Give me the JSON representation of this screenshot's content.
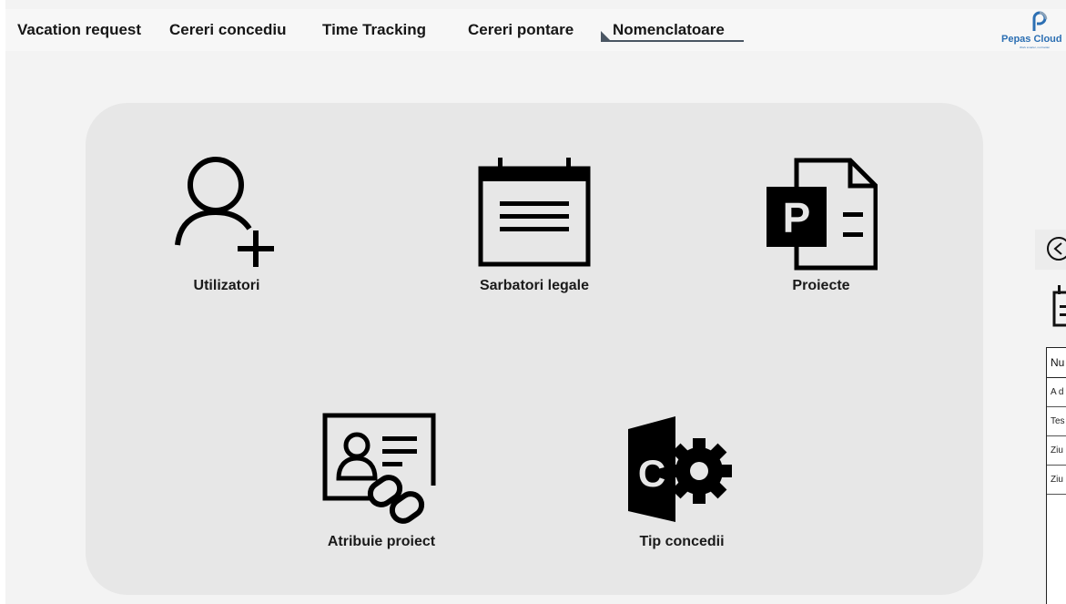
{
  "nav": {
    "items": [
      {
        "label": "Vacation request"
      },
      {
        "label": "Cereri concediu"
      },
      {
        "label": "Time Tracking"
      },
      {
        "label": "Cereri pontare"
      },
      {
        "label": "Nomenclatoare"
      }
    ],
    "active": "Nomenclatoare"
  },
  "logo": {
    "text": "Pepas Cloud",
    "tagline": "Work smarter, not harder"
  },
  "tiles": [
    {
      "label": "Utilizatori",
      "icon": "add-user-icon"
    },
    {
      "label": "Sarbatori legale",
      "icon": "calendar-icon"
    },
    {
      "label": "Proiecte",
      "icon": "project-file-icon"
    },
    {
      "label": "Atribuie proiect",
      "icon": "contact-card-link-icon"
    },
    {
      "label": "Tip concedii",
      "icon": "office-gear-icon"
    }
  ],
  "side_panel": {
    "table_header": "Nu",
    "rows": [
      "A d",
      "Tes",
      "Ziu",
      "Ziu"
    ]
  },
  "colors": {
    "background": "#f3f3f3",
    "card": "#e7e7e7",
    "accent": "#4a5663",
    "logo": "#2c6fb3"
  }
}
